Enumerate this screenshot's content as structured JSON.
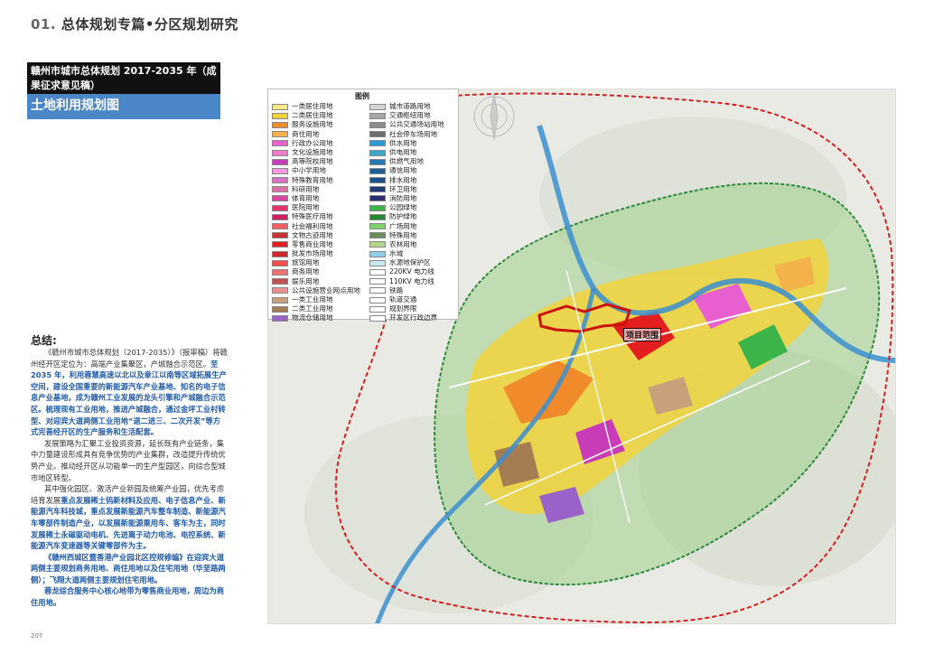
{
  "header": {
    "prefix": "01.",
    "title": "总体规划专篇•分区规划研究"
  },
  "plan": {
    "source_title": "赣州市城市总体规划 2017-2035 年（成果征求意见稿）",
    "map_title": "土地利用规划图"
  },
  "summary": {
    "heading": "总结:",
    "p1_plain": "《赣州市城市总体规划（2017-2035）》（报审稿）将赣州经开区定位为：高端产业集聚区，产城融合示范区。",
    "p1_highlight": "至 2035 年，利用蓉慧高速以北以及章江以南等区域拓展生产空间，建设全国重要的新能源汽车产业基地、知名的电子信息产业基地，成为赣州工业发展的龙头引擎和产城融合示范区。梳理现有工业用地，推进产城融合，通过金坪工业村转型、对迎宾大道两侧工业用地“退二进三、二次开发”等方式完善经开区的生产服务和生活配套。",
    "p2": "发展策略为汇聚工业投资资源，延长既有产业链条，集中力量建设形成具有竞争优势的产业集群，改造提升传统优势产业。推动经开区从功能单一的生产型园区，向综合型城市地区转型。",
    "p3_plain": "其中强化园区、激活产业新园及统筹产业园，优先考虑培育发展",
    "p3_highlight": "重点发展稀土钨新材料及应用、电子信息产业、新能源汽车科技城，重点发展新能源汽车整车制造、新能源汽车零部件制造产业，以发展新能源乘用车、客车为主，同时发展稀土永磁驱动电机、先进离子动力电池、电控系统、新能源汽车变速器等关键零部件为主。",
    "p4_highlight": "《赣州西城区暨香港产业园北区控规修编》在迎宾大道两侧主要规划商务用地、商住用地以及住宅用地（华坚路两侧）；飞翔大道两侧主要规划住宅用地。",
    "p5_highlight": "蓉龙综合服务中心核心地带为零售商业用地，周边为商住用地。"
  },
  "legend": {
    "title": "图例",
    "left": [
      {
        "label": "一类居住用地",
        "color": "#f5e98a"
      },
      {
        "label": "二类居住用地",
        "color": "#f2d23c"
      },
      {
        "label": "服务设施用地",
        "color": "#f08a2a"
      },
      {
        "label": "商住用地",
        "color": "#f4b24a"
      },
      {
        "label": "行政办公用地",
        "color": "#e85fd0"
      },
      {
        "label": "文化设施用地",
        "color": "#f07dc8"
      },
      {
        "label": "高等院校用地",
        "color": "#c93cb8"
      },
      {
        "label": "中小学用地",
        "color": "#f59ae0"
      },
      {
        "label": "特殊教育用地",
        "color": "#d771c6"
      },
      {
        "label": "科研用地",
        "color": "#e070a8"
      },
      {
        "label": "体育用地",
        "color": "#d6469a"
      },
      {
        "label": "医院用地",
        "color": "#e8306e"
      },
      {
        "label": "特殊医疗用地",
        "color": "#d02060"
      },
      {
        "label": "社会福利用地",
        "color": "#f06060"
      },
      {
        "label": "文物古迹用地",
        "color": "#c83232"
      },
      {
        "label": "零售商业用地",
        "color": "#e41e1e"
      },
      {
        "label": "批发市场用地",
        "color": "#d02828"
      },
      {
        "label": "旅馆用地",
        "color": "#ff4a4a"
      },
      {
        "label": "商务用地",
        "color": "#f07272"
      },
      {
        "label": "娱乐用地",
        "color": "#c25050"
      },
      {
        "label": "公共设施营业网点用地",
        "color": "#e89090"
      },
      {
        "label": "一类工业用地",
        "color": "#c8a07a"
      },
      {
        "label": "二类工业用地",
        "color": "#a67c52"
      },
      {
        "label": "物流仓储用地",
        "color": "#9a62c8"
      }
    ],
    "right": [
      {
        "label": "城市道路用地",
        "color": "#d4d4d4"
      },
      {
        "label": "交通枢纽用地",
        "color": "#a8a8a8"
      },
      {
        "label": "公共交通场站用地",
        "color": "#8c8c8c"
      },
      {
        "label": "社会停车场用地",
        "color": "#6e6e6e"
      },
      {
        "label": "供水用地",
        "color": "#2a9bd6"
      },
      {
        "label": "供电用地",
        "color": "#3fa8c8"
      },
      {
        "label": "供燃气用地",
        "color": "#2878b0"
      },
      {
        "label": "通信用地",
        "color": "#1e6096"
      },
      {
        "label": "排水用地",
        "color": "#1a4f8a"
      },
      {
        "label": "环卫用地",
        "color": "#203a78"
      },
      {
        "label": "消防用地",
        "color": "#2c2c6e"
      },
      {
        "label": "公园绿地",
        "color": "#3cb44a"
      },
      {
        "label": "防护绿地",
        "color": "#258a34"
      },
      {
        "label": "广场用地",
        "color": "#7cd36e"
      },
      {
        "label": "特殊用地",
        "color": "#6a8c5a"
      },
      {
        "label": "农林用地",
        "color": "#b4d88a"
      },
      {
        "label": "水域",
        "color": "#8fd0e8"
      },
      {
        "label": "水源地保护区",
        "color": "#c8e8f4"
      },
      {
        "label": "220KV 电力线",
        "color": "#ffffff"
      },
      {
        "label": "110KV 电力线",
        "color": "#ffffff"
      },
      {
        "label": "铁路",
        "color": "#ffffff"
      },
      {
        "label": "轨道交通",
        "color": "#ffffff"
      },
      {
        "label": "规划界限",
        "color": "#ffffff"
      },
      {
        "label": "开发区行政边界",
        "color": "#ffffff"
      }
    ]
  },
  "map": {
    "project_label": "项目范围"
  },
  "footer": {
    "page_number": "207"
  }
}
